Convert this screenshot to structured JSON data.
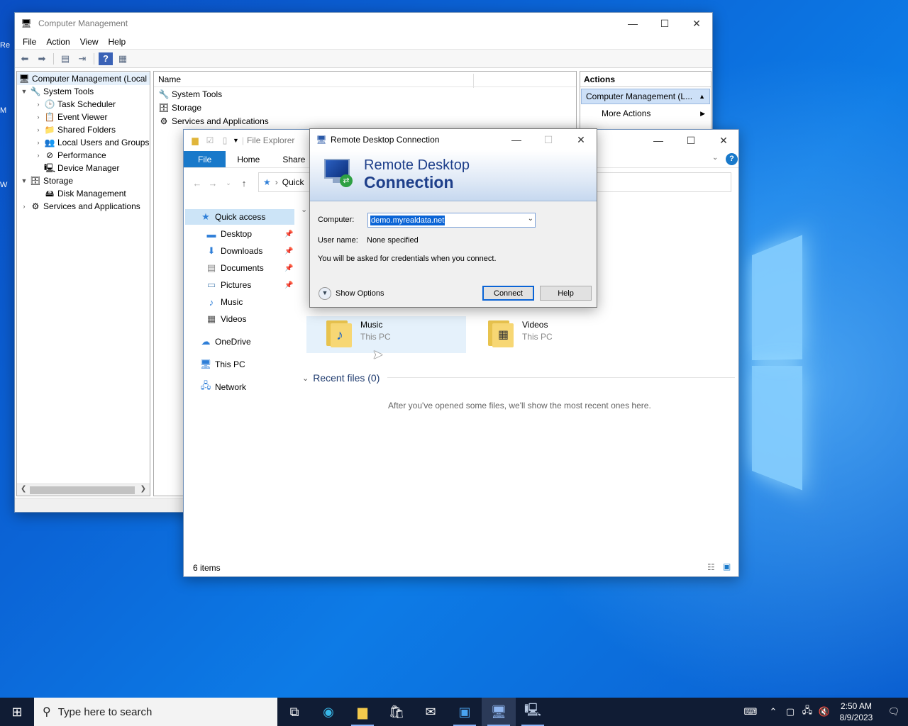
{
  "computer_management": {
    "title": "Computer Management",
    "menu": [
      "File",
      "Action",
      "View",
      "Help"
    ],
    "tree": {
      "root": "Computer Management (Local",
      "system_tools": "System Tools",
      "task_scheduler": "Task Scheduler",
      "event_viewer": "Event Viewer",
      "shared_folders": "Shared Folders",
      "local_users": "Local Users and Groups",
      "performance": "Performance",
      "device_manager": "Device Manager",
      "storage": "Storage",
      "disk_management": "Disk Management",
      "services": "Services and Applications"
    },
    "center": {
      "column": "Name",
      "rows": [
        "System Tools",
        "Storage",
        "Services and Applications"
      ]
    },
    "actions": {
      "header": "Actions",
      "selected": "Computer Management (L...",
      "more": "More Actions"
    }
  },
  "file_explorer": {
    "title": "File Explorer",
    "ribbon": [
      "File",
      "Home",
      "Share"
    ],
    "address": "Quick",
    "nav": {
      "quick_access": "Quick access",
      "desktop": "Desktop",
      "downloads": "Downloads",
      "documents": "Documents",
      "pictures": "Pictures",
      "music": "Music",
      "videos": "Videos",
      "onedrive": "OneDrive",
      "this_pc": "This PC",
      "network": "Network"
    },
    "tiles": [
      {
        "name": "Music",
        "sub": "This PC"
      },
      {
        "name": "Videos",
        "sub": "This PC"
      }
    ],
    "recent_header": "Recent files (0)",
    "recent_empty": "After you've opened some files, we'll show the most recent ones here.",
    "status": "6 items"
  },
  "rdc": {
    "title": "Remote Desktop Connection",
    "banner_line1": "Remote Desktop",
    "banner_line2": "Connection",
    "computer_label": "Computer:",
    "computer_value": "demo.myrealdata.net",
    "username_label": "User name:",
    "username_value": "None specified",
    "note": "You will be asked for credentials when you connect.",
    "show_options": "Show Options",
    "connect": "Connect",
    "help": "Help"
  },
  "taskbar": {
    "search_placeholder": "Type here to search",
    "time": "2:50 AM",
    "date": "8/9/2023"
  },
  "colors": {
    "accent": "#1979ca",
    "selection": "#0a64d6",
    "taskbar": "#101c34"
  }
}
